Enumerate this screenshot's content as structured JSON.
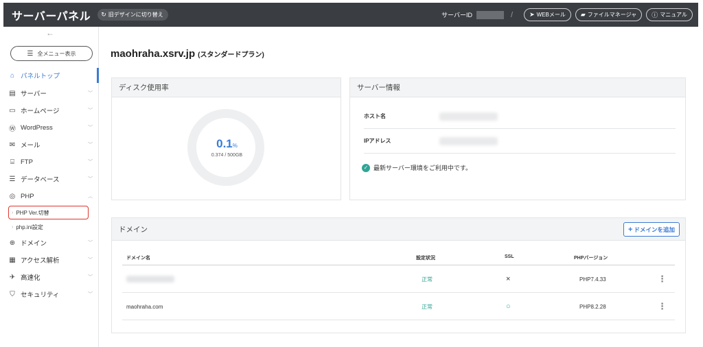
{
  "header": {
    "brand": "サーバーパネル",
    "old_design_label": "旧デザインに切り替え",
    "server_id_label": "サーバーID",
    "separator": "/",
    "links": [
      {
        "icon": "paper-plane-icon",
        "label": "WEBメール"
      },
      {
        "icon": "folder-icon",
        "label": "ファイルマネージャ"
      },
      {
        "icon": "help-circle-icon",
        "label": "マニュアル"
      }
    ]
  },
  "sidebar": {
    "all_menu_label": "全メニュー表示",
    "items": [
      {
        "icon": "home-icon",
        "label": "パネルトップ",
        "active": true
      },
      {
        "icon": "server-icon",
        "label": "サーバー"
      },
      {
        "icon": "browser-icon",
        "label": "ホームページ"
      },
      {
        "icon": "wordpress-icon",
        "label": "WordPress"
      },
      {
        "icon": "mail-icon",
        "label": "メール"
      },
      {
        "icon": "ftp-icon",
        "label": "FTP"
      },
      {
        "icon": "database-icon",
        "label": "データベース"
      },
      {
        "icon": "php-icon",
        "label": "PHP",
        "expanded": true
      },
      {
        "icon": "globe-icon",
        "label": "ドメイン"
      },
      {
        "icon": "chart-icon",
        "label": "アクセス解析"
      },
      {
        "icon": "speed-icon",
        "label": "高速化"
      },
      {
        "icon": "shield-icon",
        "label": "セキュリティ"
      }
    ],
    "php_sub": [
      {
        "label": "PHP Ver.切替",
        "highlighted": true
      },
      {
        "label": "php.ini設定"
      }
    ]
  },
  "main": {
    "title": "maohraha.xsrv.jp",
    "plan": "(スタンダードプラン)",
    "disk": {
      "heading": "ディスク使用率",
      "percent": "0.1",
      "unit": "%",
      "detail": "0.374 / 500GB"
    },
    "server_info": {
      "heading": "サーバー情報",
      "host_label": "ホスト名",
      "ip_label": "IPアドレス",
      "status": "最新サーバー環境をご利用中です。"
    },
    "domains": {
      "heading": "ドメイン",
      "add_label": "ドメインを追加",
      "columns": [
        "ドメイン名",
        "設定状況",
        "SSL",
        "PHPバージョン"
      ],
      "rows": [
        {
          "domain": "",
          "status": "正常",
          "ssl": "×",
          "php": "PHP7.4.33"
        },
        {
          "domain": "maohraha.com",
          "status": "正常",
          "ssl": "○",
          "php": "PHP8.2.28"
        }
      ]
    }
  },
  "colors": {
    "topbar": "#3a3d42",
    "accent": "#3a7bd5",
    "ok": "#2fa596",
    "highlight": "#e0342b"
  }
}
